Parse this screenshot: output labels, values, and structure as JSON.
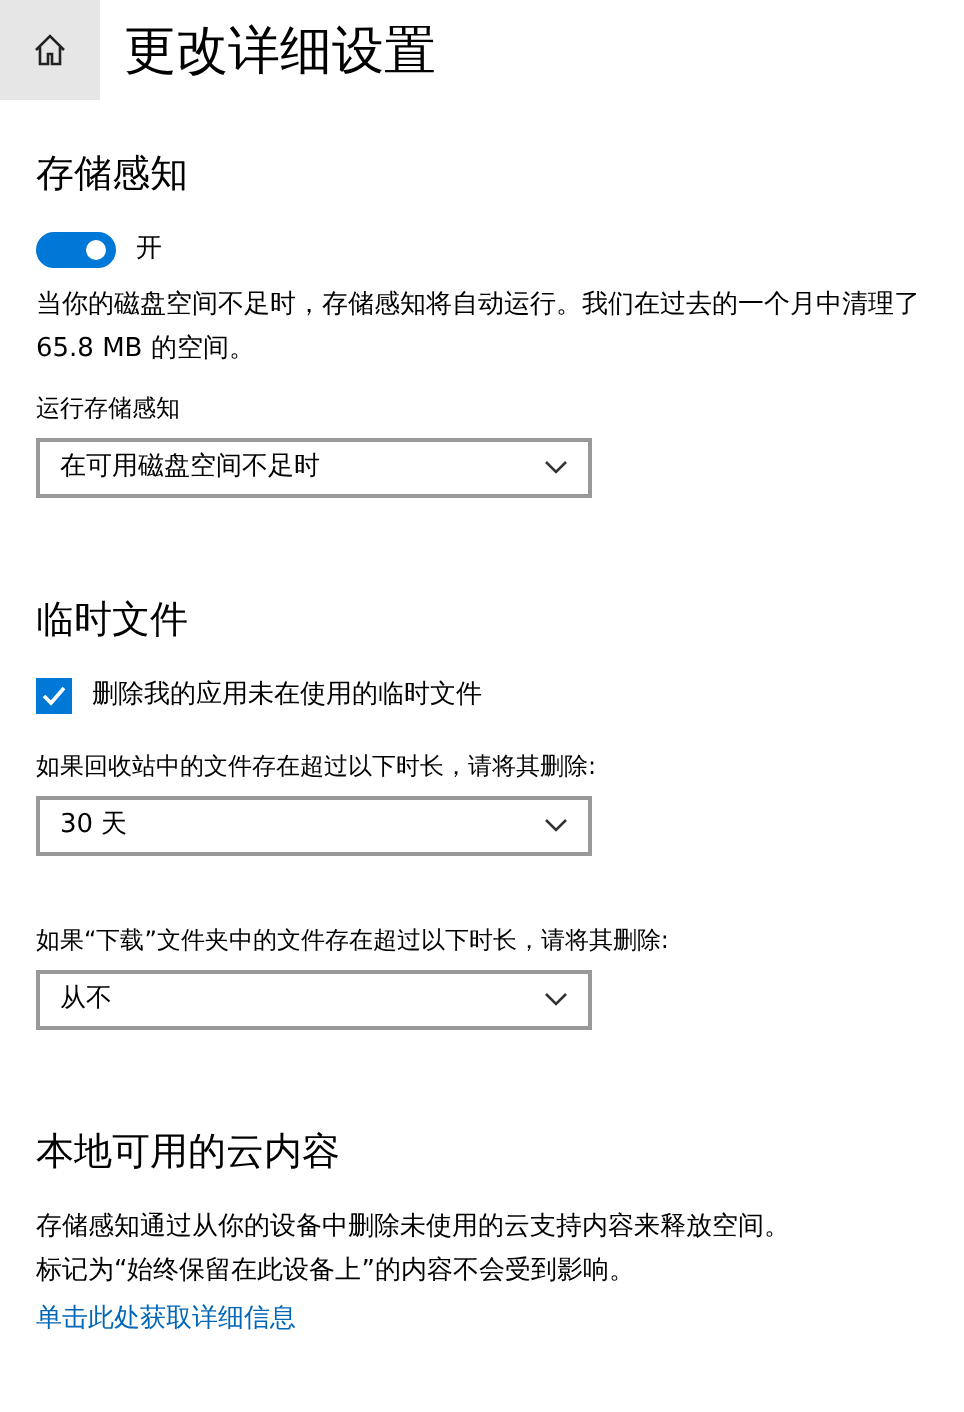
{
  "header": {
    "title": "更改详细设置"
  },
  "sections": [
    {
      "title": "存储感知",
      "items": [
        {
          "kind": "toggle",
          "on": true,
          "label": "开"
        },
        {
          "kind": "text",
          "text": "当你的磁盘空间不足时，存储感知将自动运行。我们在过去的一个月中清理了 65.8 MB 的空间。"
        },
        {
          "kind": "label",
          "text": "运行存储感知"
        },
        {
          "kind": "dropdown",
          "value": "在可用磁盘空间不足时"
        }
      ]
    },
    {
      "title": "临时文件",
      "items": [
        {
          "kind": "checkbox",
          "checked": true,
          "label": "删除我的应用未在使用的临时文件"
        },
        {
          "kind": "label",
          "text": "如果回收站中的文件存在超过以下时长，请将其删除:"
        },
        {
          "kind": "dropdown",
          "value": "30 天"
        },
        {
          "kind": "label",
          "text": "如果“下载”文件夹中的文件存在超过以下时长，请将其删除:"
        },
        {
          "kind": "dropdown",
          "value": "从不"
        }
      ]
    },
    {
      "title": "本地可用的云内容",
      "items": [
        {
          "kind": "text",
          "text": "存储感知通过从你的设备中删除未使用的云支持内容来释放空间。"
        },
        {
          "kind": "text",
          "text": "标记为“始终保留在此设备上”的内容不会受到影响。"
        },
        {
          "kind": "link",
          "text": "单击此处获取详细信息"
        }
      ]
    }
  ]
}
